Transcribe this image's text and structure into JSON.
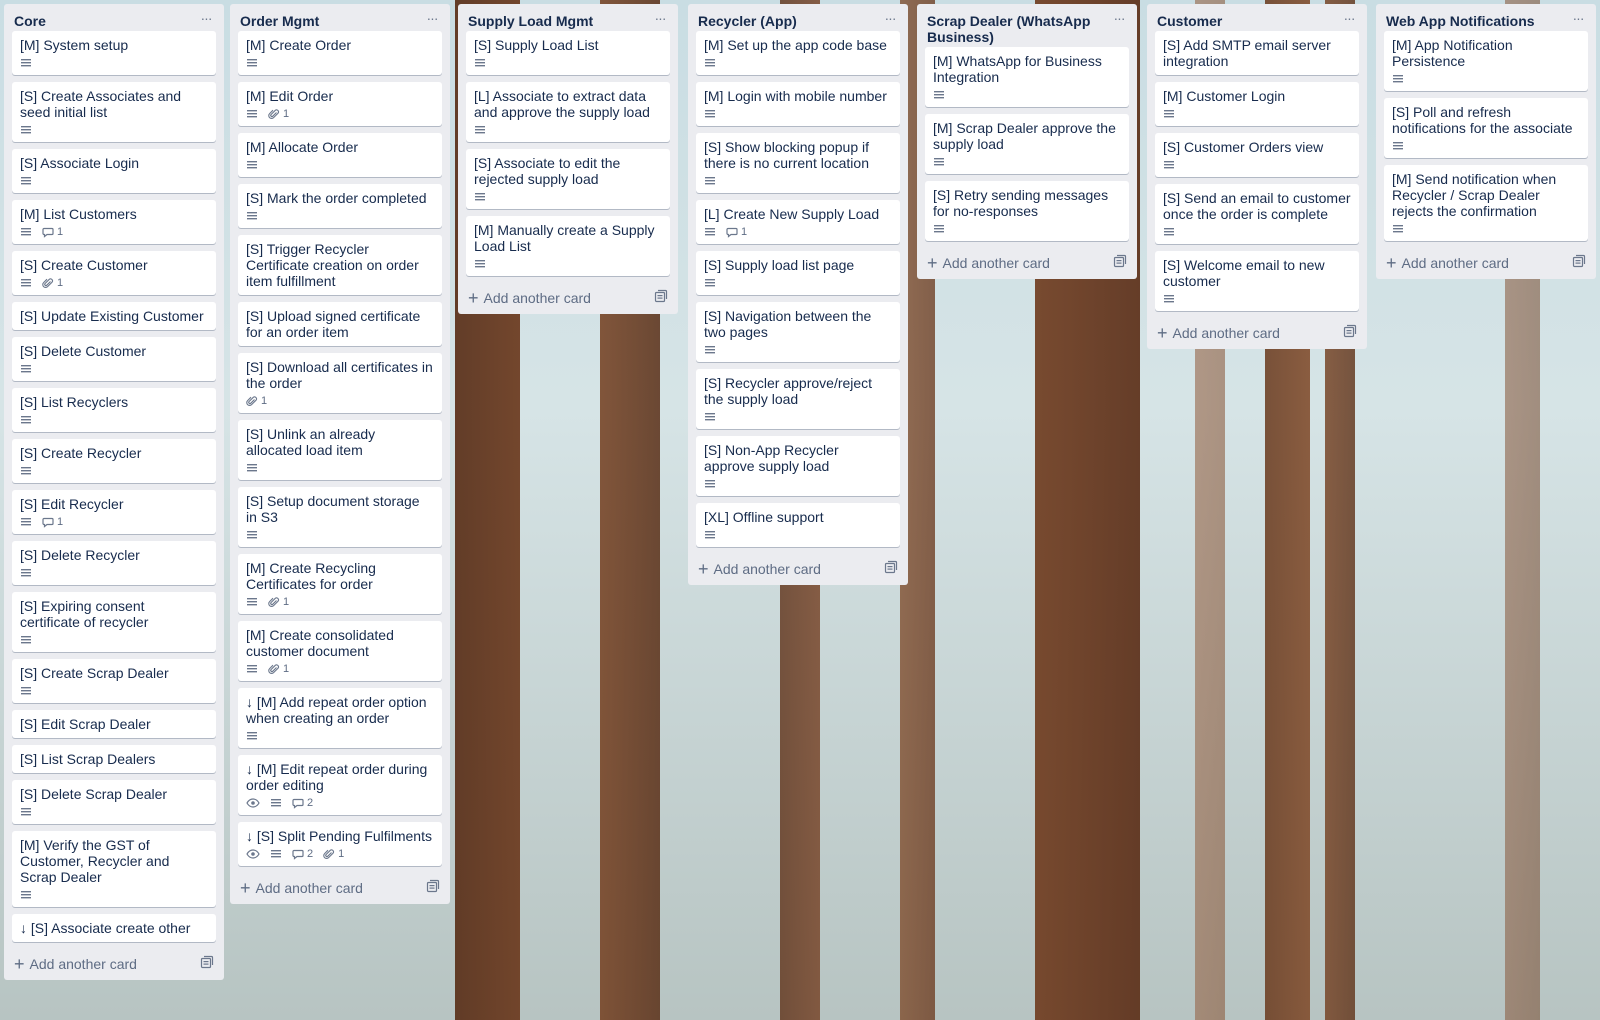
{
  "add_card_label": "Add another card",
  "lists": [
    {
      "title": "Core",
      "cards": [
        {
          "title": "[M] System setup",
          "desc": true
        },
        {
          "title": "[S] Create Associates and seed initial list",
          "desc": true
        },
        {
          "title": "[S] Associate Login",
          "desc": true
        },
        {
          "title": "[M] List Customers",
          "desc": true,
          "comments": "1"
        },
        {
          "title": "[S] Create Customer",
          "desc": true,
          "attachments": "1"
        },
        {
          "title": "[S] Update Existing Customer"
        },
        {
          "title": "[S] Delete Customer",
          "desc": true
        },
        {
          "title": "[S] List Recyclers",
          "desc": true
        },
        {
          "title": "[S] Create Recycler",
          "desc": true
        },
        {
          "title": "[S] Edit Recycler",
          "desc": true,
          "comments": "1"
        },
        {
          "title": "[S] Delete Recycler",
          "desc": true
        },
        {
          "title": "[S] Expiring consent certificate of recycler",
          "desc": true
        },
        {
          "title": "[S] Create Scrap Dealer",
          "desc": true
        },
        {
          "title": "[S] Edit Scrap Dealer"
        },
        {
          "title": "[S] List Scrap Dealers"
        },
        {
          "title": "[S] Delete Scrap Dealer",
          "desc": true
        },
        {
          "title": "[M] Verify the GST of Customer, Recycler and Scrap Dealer",
          "desc": true
        },
        {
          "title": "↓ [S] Associate create other"
        }
      ]
    },
    {
      "title": "Order Mgmt",
      "cards": [
        {
          "title": "[M] Create Order",
          "desc": true
        },
        {
          "title": "[M] Edit Order",
          "desc": true,
          "attachments": "1"
        },
        {
          "title": "[M] Allocate Order",
          "desc": true
        },
        {
          "title": "[S] Mark the order completed",
          "desc": true
        },
        {
          "title": "[S] Trigger Recycler Certificate creation on order item fulfillment"
        },
        {
          "title": "[S] Upload signed certificate for an order item"
        },
        {
          "title": "[S] Download all certificates in the order",
          "attachments": "1"
        },
        {
          "title": "[S] Unlink an already allocated load item",
          "desc": true
        },
        {
          "title": "[S] Setup document storage in S3",
          "desc": true
        },
        {
          "title": "[M] Create Recycling Certificates for order",
          "desc": true,
          "attachments": "1"
        },
        {
          "title": "[M] Create consolidated customer document",
          "desc": true,
          "attachments": "1"
        },
        {
          "title": "↓ [M] Add repeat order option when creating an order",
          "desc": true
        },
        {
          "title": "↓ [M] Edit repeat order during order editing",
          "watch": true,
          "desc": true,
          "comments": "2"
        },
        {
          "title": "↓ [S] Split Pending Fulfilments",
          "watch": true,
          "desc": true,
          "comments": "2",
          "attachments": "1"
        }
      ]
    },
    {
      "title": "Supply Load Mgmt",
      "cards": [
        {
          "title": "[S] Supply Load List",
          "desc": true
        },
        {
          "title": "[L] Associate to extract data and approve the supply load",
          "desc": true
        },
        {
          "title": "[S] Associate to edit the rejected supply load",
          "desc": true
        },
        {
          "title": "[M] Manually create a Supply Load List",
          "desc": true
        }
      ]
    },
    {
      "title": "Recycler (App)",
      "cards": [
        {
          "title": "[M] Set up the app code base",
          "desc": true
        },
        {
          "title": "[M] Login with mobile number",
          "desc": true
        },
        {
          "title": "[S] Show blocking popup if there is no current location",
          "desc": true
        },
        {
          "title": "[L] Create New Supply Load",
          "desc": true,
          "comments": "1"
        },
        {
          "title": "[S] Supply load list page",
          "desc": true
        },
        {
          "title": "[S] Navigation between the two pages",
          "desc": true
        },
        {
          "title": "[S] Recycler approve/reject the supply load",
          "desc": true
        },
        {
          "title": "[S] Non-App Recycler approve supply load",
          "desc": true
        },
        {
          "title": "[XL] Offline support",
          "desc": true
        }
      ]
    },
    {
      "title": "Scrap Dealer (WhatsApp Business)",
      "cards": [
        {
          "title": "[M] WhatsApp for Business Integration",
          "desc": true
        },
        {
          "title": "[M] Scrap Dealer approve the supply load",
          "desc": true
        },
        {
          "title": "[S] Retry sending messages for no-responses",
          "desc": true
        }
      ]
    },
    {
      "title": "Customer",
      "cards": [
        {
          "title": "[S] Add SMTP email server integration"
        },
        {
          "title": "[M] Customer Login",
          "desc": true
        },
        {
          "title": "[S] Customer Orders view",
          "desc": true
        },
        {
          "title": "[S] Send an email to customer once the order is complete",
          "desc": true
        },
        {
          "title": "[S] Welcome email to new customer",
          "desc": true
        }
      ]
    },
    {
      "title": "Web App Notifications",
      "cards": [
        {
          "title": "[M] App Notification Persistence",
          "desc": true
        },
        {
          "title": "[S] Poll and refresh notifications for the associate",
          "desc": true
        },
        {
          "title": "[M] Send notification when Recycler / Scrap Dealer rejects the confirmation",
          "desc": true
        }
      ]
    }
  ]
}
